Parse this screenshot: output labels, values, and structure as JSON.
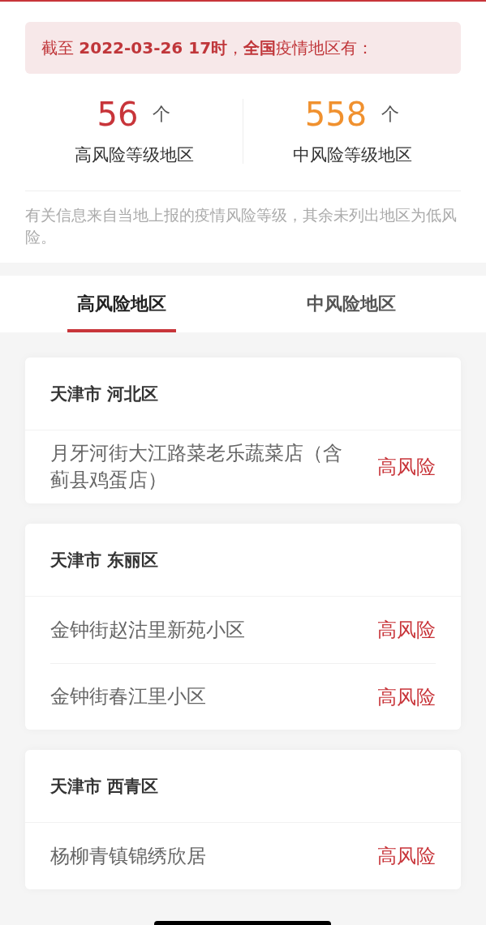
{
  "banner": "截至 **2022-03-26 17时**，**全国**疫情地区有：",
  "stats": [
    {
      "count": "56",
      "unit": "个",
      "label": "高风险等级地区",
      "color": "#c8353a"
    },
    {
      "count": "558",
      "unit": "个",
      "label": "中风险等级地区",
      "color": "#f0912f"
    }
  ],
  "note": "有关信息来自当地上报的疫情风险等级，其余未列出地区为低风险。",
  "tabs": [
    {
      "label": "高风险地区",
      "selected": true
    },
    {
      "label": "中风险地区",
      "selected": false
    }
  ],
  "groups": [
    {
      "title": "天津市 河北区",
      "places": [
        {
          "name": "月牙河街大江路菜老乐蔬菜店（含蓟县鸡蛋店）",
          "risk": "高风险",
          "kind": "high"
        }
      ]
    },
    {
      "title": "天津市 东丽区",
      "places": [
        {
          "name": "金钟街赵沽里新苑小区",
          "risk": "高风险",
          "kind": "high"
        },
        {
          "name": "金钟街春江里小区",
          "risk": "高风险",
          "kind": "high"
        }
      ]
    },
    {
      "title": "天津市 西青区",
      "places": [
        {
          "name": "杨柳青镇锦绣欣居",
          "risk": "高风险",
          "kind": "high"
        }
      ]
    }
  ]
}
